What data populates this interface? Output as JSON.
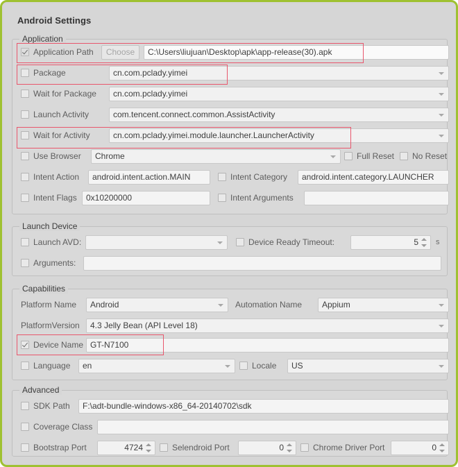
{
  "window": {
    "title": "Android Settings",
    "accent_border_color": "#9fc131",
    "background_color": "#d6d6d6",
    "highlight_color": "#e8566c"
  },
  "groups": {
    "application": {
      "title": "Application",
      "rows": {
        "application_path": {
          "label": "Application Path",
          "checked": true,
          "button_label": "Choose",
          "value": "C:\\Users\\liujuan\\Desktop\\apk\\app-release(30).apk"
        },
        "package": {
          "label": "Package",
          "checked": false,
          "value": "cn.com.pclady.yimei"
        },
        "wait_for_package": {
          "label": "Wait for Package",
          "checked": false,
          "value": "cn.com.pclady.yimei"
        },
        "launch_activity": {
          "label": "Launch Activity",
          "checked": false,
          "value": "com.tencent.connect.common.AssistActivity"
        },
        "wait_for_activity": {
          "label": "Wait for Activity",
          "checked": false,
          "value": "cn.com.pclady.yimei.module.launcher.LauncherActivity"
        },
        "use_browser": {
          "label": "Use Browser",
          "checked": false,
          "value": "Chrome"
        },
        "full_reset": {
          "label": "Full Reset",
          "checked": false
        },
        "no_reset": {
          "label": "No Reset",
          "checked": false
        },
        "intent_action": {
          "label": "Intent Action",
          "checked": false,
          "value": "android.intent.action.MAIN"
        },
        "intent_category": {
          "label": "Intent Category",
          "checked": false,
          "value": "android.intent.category.LAUNCHER"
        },
        "intent_flags": {
          "label": "Intent Flags",
          "checked": false,
          "value": "0x10200000"
        },
        "intent_arguments": {
          "label": "Intent Arguments",
          "checked": false,
          "value": ""
        }
      }
    },
    "launch_device": {
      "title": "Launch Device",
      "rows": {
        "launch_avd": {
          "label": "Launch AVD:",
          "checked": false,
          "value": ""
        },
        "device_ready_timeout": {
          "label": "Device Ready Timeout:",
          "checked": false,
          "value": "5",
          "unit": "s"
        },
        "arguments": {
          "label": "Arguments:",
          "checked": false,
          "value": ""
        }
      }
    },
    "capabilities": {
      "title": "Capabilities",
      "rows": {
        "platform_name": {
          "label": "Platform Name",
          "value": "Android"
        },
        "automation_name": {
          "label": "Automation Name",
          "value": "Appium"
        },
        "platform_version": {
          "label": "PlatformVersion",
          "value": "4.3 Jelly Bean (API Level 18)"
        },
        "device_name": {
          "label": "Device Name",
          "checked": true,
          "value": "GT-N7100"
        },
        "language": {
          "label": "Language",
          "checked": false,
          "value": "en"
        },
        "locale": {
          "label": "Locale",
          "checked": false,
          "value": "US"
        }
      }
    },
    "advanced": {
      "title": "Advanced",
      "rows": {
        "sdk_path": {
          "label": "SDK Path",
          "checked": false,
          "value": "F:\\adt-bundle-windows-x86_64-20140702\\sdk"
        },
        "coverage_class": {
          "label": "Coverage Class",
          "checked": false,
          "value": ""
        },
        "bootstrap_port": {
          "label": "Bootstrap Port",
          "checked": false,
          "value": "4724"
        },
        "selendroid_port": {
          "label": "Selendroid Port",
          "checked": false,
          "value": "0"
        },
        "chrome_driver_port": {
          "label": "Chrome Driver Port",
          "checked": false,
          "value": "0"
        }
      }
    }
  }
}
